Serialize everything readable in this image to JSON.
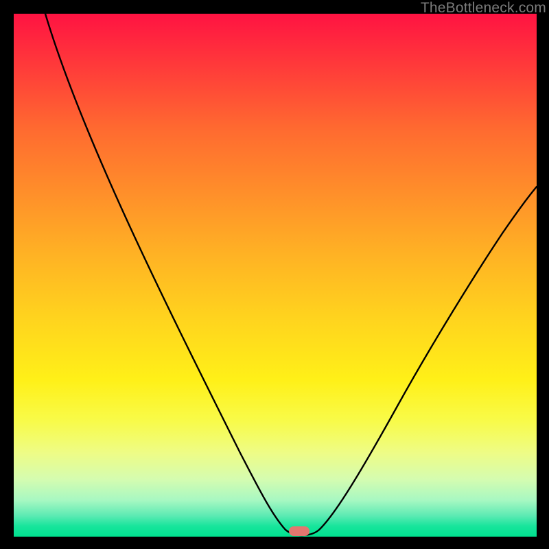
{
  "watermark": {
    "text": "TheBottleneck.com"
  },
  "marker": {
    "x_pct": 54.6,
    "y_pct": 99.0,
    "color": "#e3766f"
  },
  "chart_data": {
    "type": "line",
    "title": "",
    "xlabel": "",
    "ylabel": "",
    "xlim": [
      0,
      100
    ],
    "ylim": [
      0,
      100
    ],
    "grid": false,
    "legend": false,
    "annotations": [
      "TheBottleneck.com"
    ],
    "series": [
      {
        "name": "bottleneck-curve",
        "x": [
          6,
          10,
          15,
          20,
          25,
          30,
          35,
          40,
          45,
          50,
          52,
          54,
          56,
          58,
          60,
          65,
          70,
          75,
          80,
          85,
          90,
          95,
          100
        ],
        "y": [
          100,
          92,
          83,
          74,
          66,
          54,
          45,
          36,
          26,
          12,
          4,
          0,
          0,
          1,
          3,
          12,
          22,
          32,
          41,
          49,
          56,
          62,
          67
        ]
      }
    ],
    "optimum": {
      "x": 55,
      "y": 0
    },
    "gradient_stops": [
      {
        "pos": 0,
        "color": "#ff1342"
      },
      {
        "pos": 10,
        "color": "#ff3a3a"
      },
      {
        "pos": 22,
        "color": "#ff6a30"
      },
      {
        "pos": 34,
        "color": "#ff8e2a"
      },
      {
        "pos": 46,
        "color": "#ffb224"
      },
      {
        "pos": 58,
        "color": "#ffd31e"
      },
      {
        "pos": 70,
        "color": "#fff018"
      },
      {
        "pos": 78,
        "color": "#f8fb4a"
      },
      {
        "pos": 84,
        "color": "#eefc86"
      },
      {
        "pos": 89,
        "color": "#d5fcb0"
      },
      {
        "pos": 93,
        "color": "#a8f8c2"
      },
      {
        "pos": 96,
        "color": "#5ceab3"
      },
      {
        "pos": 98,
        "color": "#17e59c"
      },
      {
        "pos": 100,
        "color": "#00e18f"
      }
    ]
  }
}
